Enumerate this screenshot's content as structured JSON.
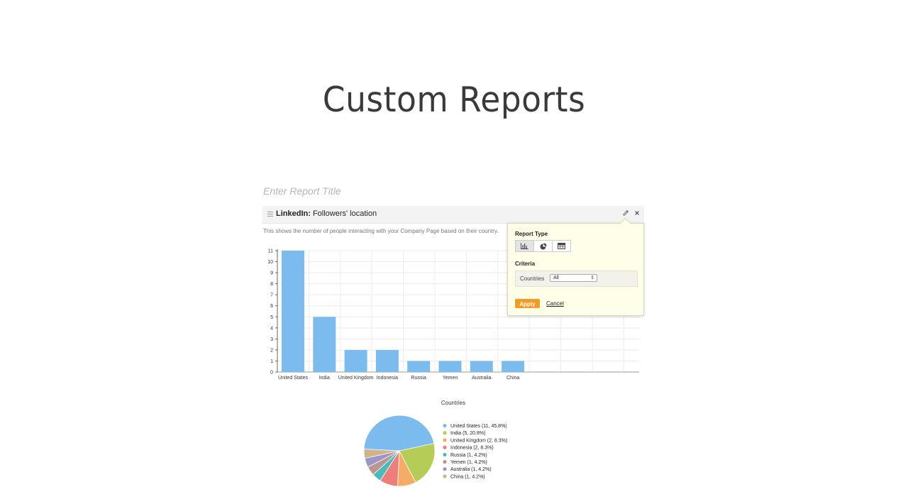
{
  "page": {
    "title": "Custom Reports"
  },
  "report": {
    "title_placeholder": "Enter Report Title",
    "widget": {
      "source": "LinkedIn:",
      "title": "Followers' location",
      "description": "This shows the number of people interacting with your Company Page based on their country.",
      "edit_icon": "pencil-icon",
      "close_icon": "close-icon"
    }
  },
  "popover": {
    "report_type_label": "Report Type",
    "report_types": [
      "bar-chart-icon",
      "pie-chart-icon",
      "table-icon"
    ],
    "active_report_type": 0,
    "criteria_label": "Criteria",
    "countries_label": "Countries",
    "countries_value": "All",
    "apply_label": "Apply",
    "cancel_label": "Cancel",
    "accent_color": "#f39a27"
  },
  "chart_data": [
    {
      "type": "bar",
      "categories": [
        "United States",
        "India",
        "United Kingdom",
        "Indonesia",
        "Russia",
        "Yemen",
        "Australia",
        "China"
      ],
      "values": [
        11,
        5,
        2,
        2,
        1,
        1,
        1,
        1
      ],
      "ylim": [
        0,
        11
      ],
      "yticks": [
        "0",
        "1",
        "2",
        "3",
        "4",
        "5",
        "6",
        "7",
        "8",
        "9",
        "10",
        "11"
      ],
      "grid": true,
      "color": "#7cbbee"
    },
    {
      "type": "pie",
      "title": "Countries",
      "slices": [
        {
          "label": "United States (11, 45.8%)",
          "value": 11,
          "color": "#7cbbee"
        },
        {
          "label": "India (5, 20.8%)",
          "value": 5,
          "color": "#b5cd56"
        },
        {
          "label": "United Kingdom (2, 8.3%)",
          "value": 2,
          "color": "#f4ac68"
        },
        {
          "label": "Indonesia (2, 8.3%)",
          "value": 2,
          "color": "#ee7e7a"
        },
        {
          "label": "Russia (1, 4.2%)",
          "value": 1,
          "color": "#4bbab8"
        },
        {
          "label": "Yemen (1, 4.2%)",
          "value": 1,
          "color": "#b99790"
        },
        {
          "label": "Australia (1, 4.2%)",
          "value": 1,
          "color": "#9d95c6"
        },
        {
          "label": "China (1, 4.2%)",
          "value": 1,
          "color": "#cfb38a"
        }
      ],
      "legend_position": "right"
    }
  ]
}
